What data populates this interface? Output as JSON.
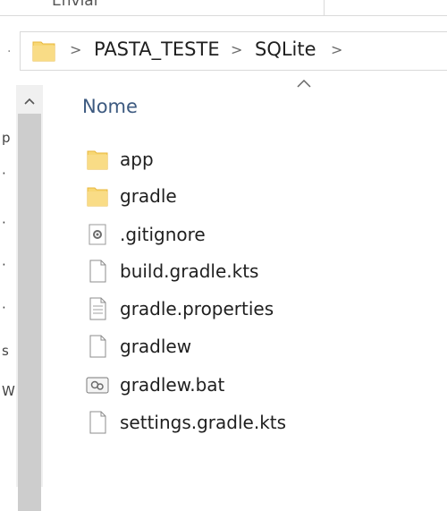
{
  "ribbon": {
    "label": "Enviar"
  },
  "address": {
    "crumbs": [
      "PASTA_TESTE",
      "SQLite"
    ]
  },
  "nav": {
    "edge_letters": [
      "p",
      "s",
      "W"
    ]
  },
  "list": {
    "column_name": "Nome",
    "items": [
      {
        "name": "app",
        "icon": "folder-icon"
      },
      {
        "name": "gradle",
        "icon": "folder-icon"
      },
      {
        "name": ".gitignore",
        "icon": "settings-file-icon"
      },
      {
        "name": "build.gradle.kts",
        "icon": "file-icon"
      },
      {
        "name": "gradle.properties",
        "icon": "text-file-icon"
      },
      {
        "name": "gradlew",
        "icon": "file-icon"
      },
      {
        "name": "gradlew.bat",
        "icon": "batch-file-icon"
      },
      {
        "name": "settings.gradle.kts",
        "icon": "file-icon"
      }
    ]
  },
  "colors": {
    "folder_fill": "#f7d774",
    "folder_shade": "#e8b73d",
    "header_text": "#3d5a80",
    "scrollbar_track": "#f0f0f0",
    "scrollbar_thumb": "#cdcdcd"
  }
}
